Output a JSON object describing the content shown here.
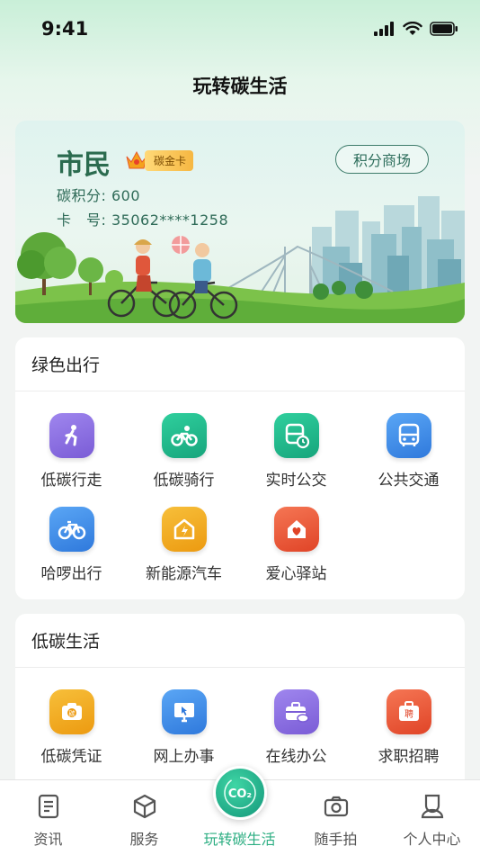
{
  "status_bar": {
    "time": "9:41",
    "icons": [
      "signal-icon",
      "wifi-icon",
      "battery-icon"
    ]
  },
  "header": {
    "title": "玩转碳生活"
  },
  "card": {
    "name": "市民",
    "badge": "碳金卡",
    "points_label": "碳积分:",
    "points_value": "600",
    "card_no_label": "卡　号:",
    "card_no_value": "35062****1258",
    "mall_button": "积分商场"
  },
  "green_travel": {
    "title": "绿色出行",
    "items": [
      {
        "label": "低碳行走",
        "icon": "walking-icon",
        "color": "#8a6fe0"
      },
      {
        "label": "低碳骑行",
        "icon": "bike-icon",
        "color": "#22b38a"
      },
      {
        "label": "实时公交",
        "icon": "bus-clock-icon",
        "color": "#22b38a"
      },
      {
        "label": "公共交通",
        "icon": "bus-icon",
        "color": "#3f8ce8"
      },
      {
        "label": "哈啰出行",
        "icon": "bicycle-icon",
        "color": "#3f8ce8"
      },
      {
        "label": "新能源汽车",
        "icon": "charging-icon",
        "color": "#f0a91c"
      },
      {
        "label": "爱心驿站",
        "icon": "heart-house-icon",
        "color": "#ee5a3a"
      }
    ]
  },
  "low_carbon_life": {
    "title": "低碳生活",
    "items": [
      {
        "label": "低碳凭证",
        "icon": "voucher-icon",
        "color": "#f0a91c"
      },
      {
        "label": "网上办事",
        "icon": "monitor-icon",
        "color": "#3f8ce8"
      },
      {
        "label": "在线办公",
        "icon": "briefcase-icon",
        "color": "#8a6fe0"
      },
      {
        "label": "求职招聘",
        "icon": "job-icon",
        "color": "#ee5a3a"
      }
    ]
  },
  "tab_bar": {
    "items": [
      {
        "label": "资讯",
        "icon": "news-icon"
      },
      {
        "label": "服务",
        "icon": "cube-icon"
      },
      {
        "label": "玩转碳生活",
        "icon": "co2-icon",
        "badge_text": "CO₂",
        "active": true
      },
      {
        "label": "随手拍",
        "icon": "camera-icon"
      },
      {
        "label": "个人中心",
        "icon": "user-icon"
      }
    ]
  },
  "colors": {
    "accent": "#2cae82",
    "card_text": "#2f6b58"
  }
}
